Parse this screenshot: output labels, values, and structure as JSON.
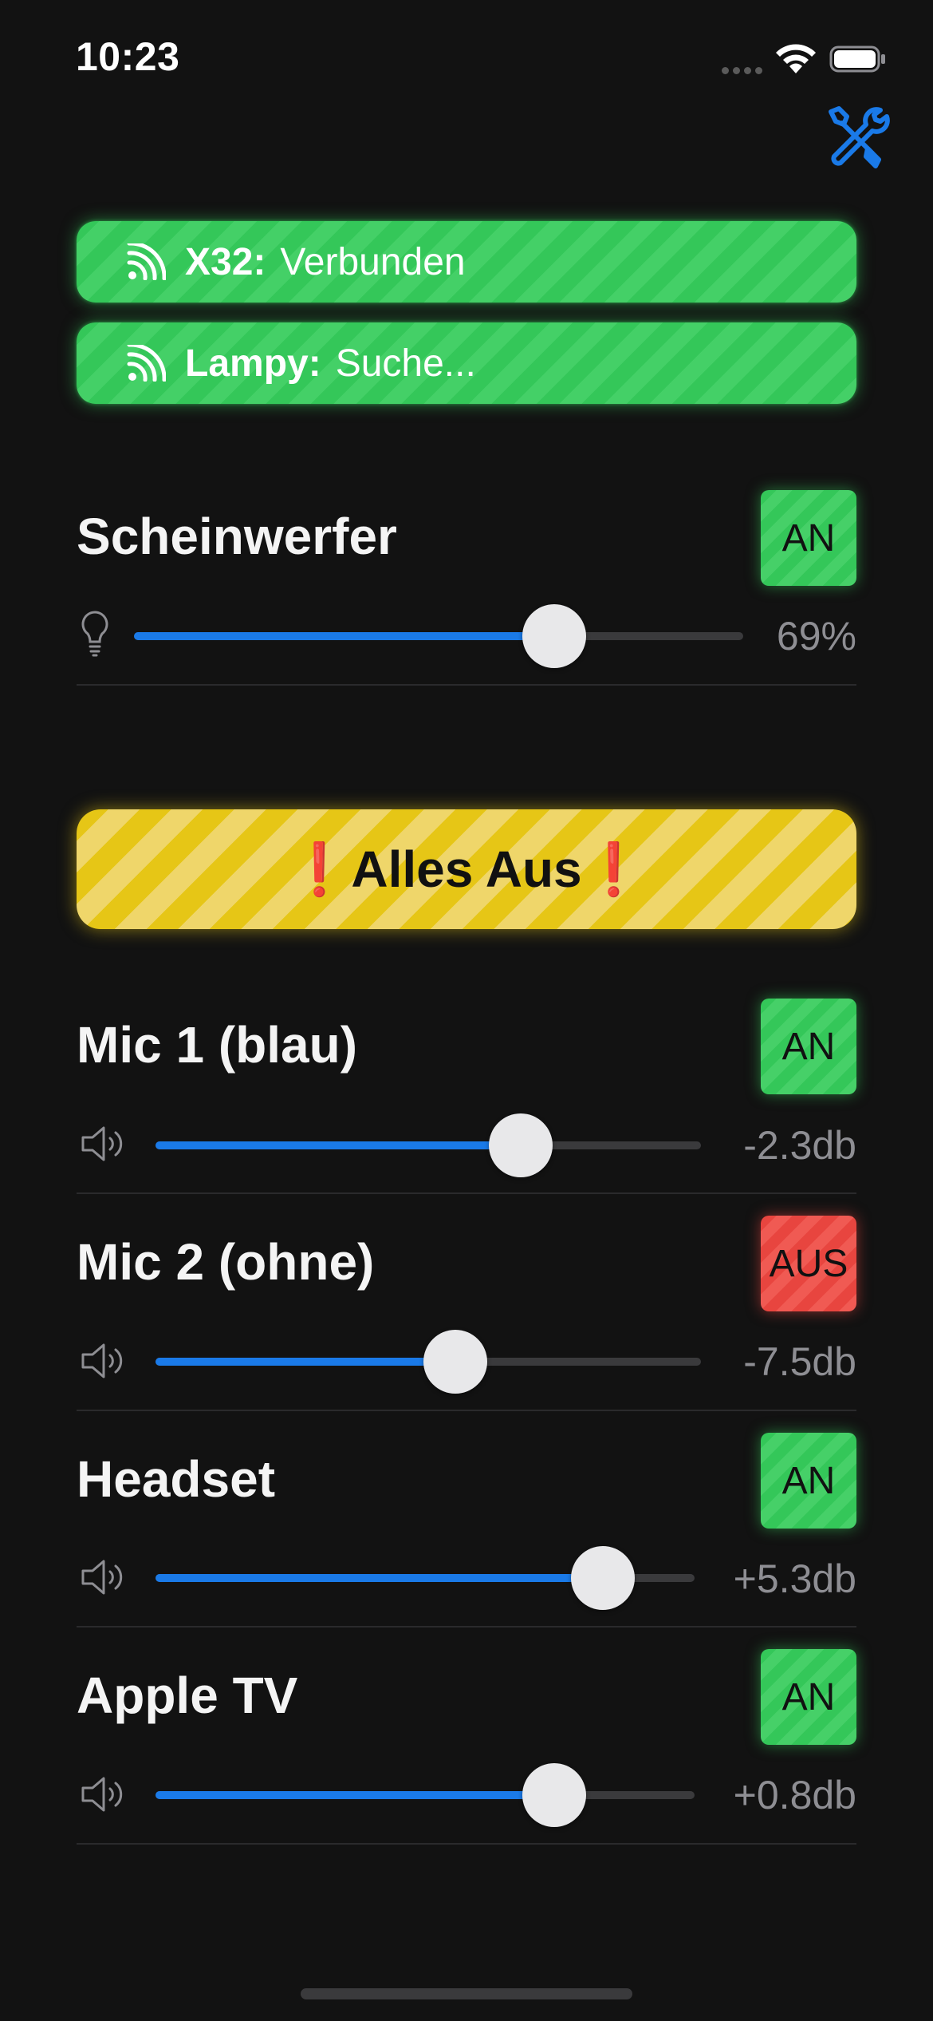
{
  "status_bar": {
    "time": "10:23"
  },
  "toolbar": {
    "settings_icon": "tools-icon",
    "accent_color": "#1a7ae8"
  },
  "connections": [
    {
      "icon": "rss-icon",
      "label": "X32:",
      "value": "Verbunden",
      "color": "#34c759"
    },
    {
      "icon": "rss-icon",
      "label": "Lampy:",
      "value": "Suche...",
      "color": "#34c759"
    }
  ],
  "spotlight": {
    "title": "Scheinwerfer",
    "toggle": "AN",
    "toggle_state": "on",
    "icon": "lightbulb-icon",
    "level": 0.69,
    "value": "69%"
  },
  "all_off_button": {
    "label": "❗️Alles Aus❗️",
    "color": "#e6c616"
  },
  "channels": [
    {
      "title": "Mic 1 (blau)",
      "toggle": "AN",
      "toggle_state": "on",
      "icon": "speaker-icon",
      "level": 0.67,
      "value": "-2.3db"
    },
    {
      "title": "Mic 2 (ohne)",
      "toggle": "AUS",
      "toggle_state": "off",
      "icon": "speaker-icon",
      "level": 0.55,
      "value": "-7.5db"
    },
    {
      "title": "Headset",
      "toggle": "AN",
      "toggle_state": "on",
      "icon": "speaker-icon",
      "level": 0.83,
      "value": "+5.3db"
    },
    {
      "title": "Apple TV",
      "toggle": "AN",
      "toggle_state": "on",
      "icon": "speaker-icon",
      "level": 0.74,
      "value": "+0.8db"
    }
  ],
  "colors": {
    "on": "#34c759",
    "off": "#e8453f",
    "slider": "#1a7ae8",
    "background": "#121212"
  }
}
